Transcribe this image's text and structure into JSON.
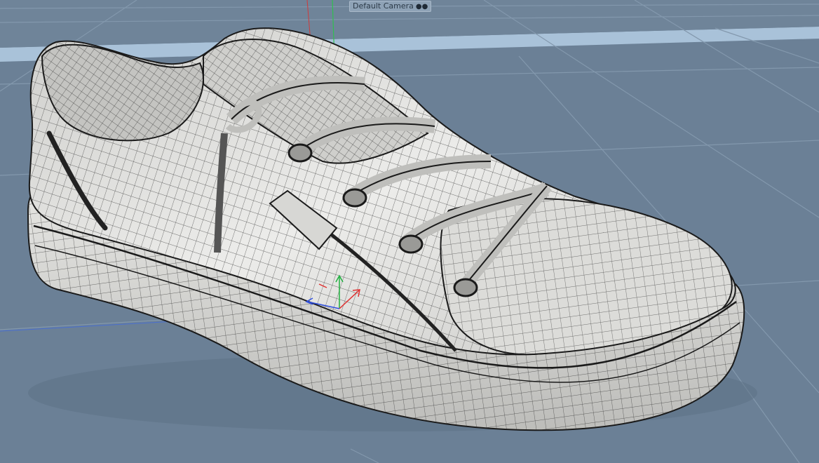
{
  "viewport": {
    "camera_name": "Default Camera",
    "camera_icon": "camera-icon",
    "model": "sneaker-wireframe",
    "colors": {
      "background": "#6b8096",
      "grid_line": "#7f93a7",
      "horizon": "#a9c2d9",
      "mesh_fill": "#d9d9d6",
      "mesh_shade": "#b9b9b6",
      "wire": "#1b1b1b",
      "axis_x": "#e03030",
      "axis_y": "#20b040",
      "axis_z": "#3050e0"
    }
  }
}
